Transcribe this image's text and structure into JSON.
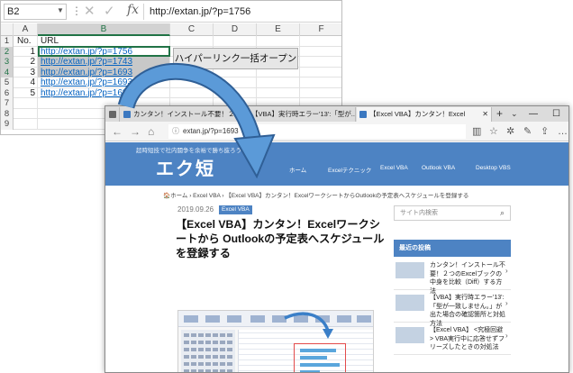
{
  "excel": {
    "name_box": "B2",
    "formula_value": "http://extan.jp/?p=1756",
    "columns": [
      "A",
      "B",
      "C",
      "D",
      "E",
      "F"
    ],
    "rows": [
      {
        "num": "1",
        "a": "No.",
        "b": "URL",
        "link": false,
        "sel": false,
        "grey": false
      },
      {
        "num": "2",
        "a": "1",
        "b": "http://extan.jp/?p=1756",
        "link": true,
        "sel": true,
        "grey": false
      },
      {
        "num": "3",
        "a": "2",
        "b": "http://extan.jp/?p=1743",
        "link": true,
        "sel": true,
        "grey": true
      },
      {
        "num": "4",
        "a": "3",
        "b": "http://extan.jp/?p=1693",
        "link": true,
        "sel": true,
        "grey": true
      },
      {
        "num": "5",
        "a": "4",
        "b": "http://extan.jp/?p=1693",
        "link": true,
        "sel": false,
        "grey": false
      },
      {
        "num": "6",
        "a": "5",
        "b": "http://extan.jp/?p=1696",
        "link": true,
        "sel": false,
        "grey": false
      },
      {
        "num": "7",
        "a": "",
        "b": "",
        "link": false,
        "sel": false,
        "grey": false
      },
      {
        "num": "8",
        "a": "",
        "b": "",
        "link": false,
        "sel": false,
        "grey": false
      },
      {
        "num": "9",
        "a": "",
        "b": "",
        "link": false,
        "sel": false,
        "grey": false
      }
    ],
    "macro_button": "ハイパーリンク一括オープン"
  },
  "browser": {
    "tabs": [
      {
        "label": "カンタン！インストール不要！２"
      },
      {
        "label": "【VBA】実行時エラー'13':「型が..."
      },
      {
        "label": "【Excel VBA】カンタン！Excel"
      }
    ],
    "url": "extan.jp/?p=1693",
    "site": {
      "tagline": "超時短技で社内闘争を余裕で勝ち抜ろう！",
      "logo": "エク短",
      "nav": [
        "ホーム",
        "Excelテクニック",
        "Excel VBA",
        "Outlook VBA",
        "Desktop VBS"
      ],
      "breadcrumb": "🏠ホーム › Excel VBA › 【Excel VBA】カンタン！ExcelワークシートからOutlookの予定表へスケジュールを登録する"
    },
    "post": {
      "date": "2019.09.26",
      "category": "Excel VBA",
      "title": "【Excel VBA】カンタン！Excelワークシートから Outlookの予定表へスケジュールを登録する"
    },
    "sidebar": {
      "search_placeholder": "サイト内検索",
      "recent_heading": "最近の投稿",
      "recent": [
        {
          "text": "カンタン！インストール不要！２つのExcelブックの中身を比較（Diff）する方法"
        },
        {
          "text": "【VBA】実行時エラー'13':「型が一致しません。」が出た場合の確認箇所と対処方法"
        },
        {
          "text": "【Excel VBA】 <究極回避> VBA実行中に応答せずフリーズしたときの対処法"
        }
      ]
    }
  }
}
